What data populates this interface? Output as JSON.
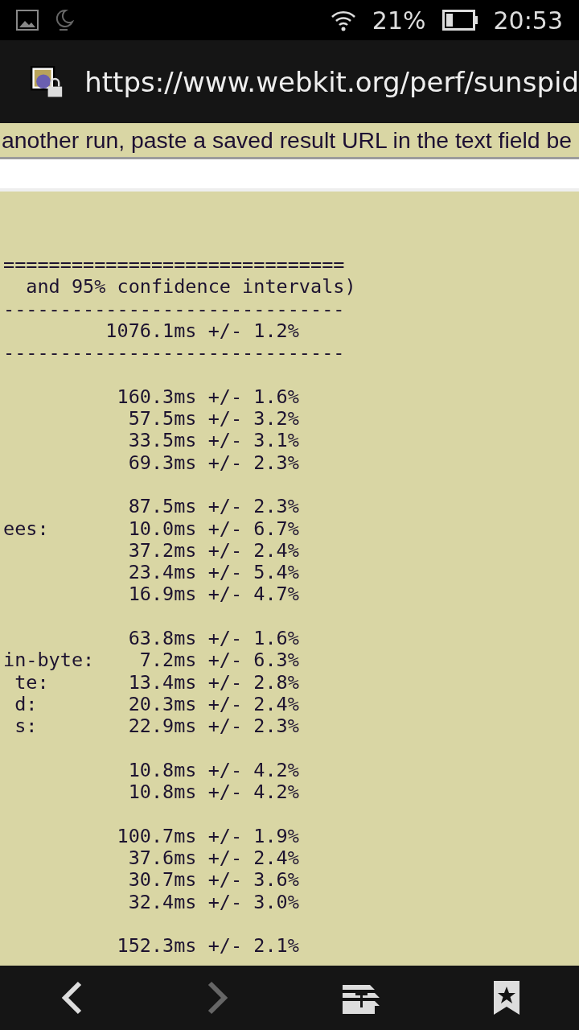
{
  "status_bar": {
    "time": "20:53",
    "battery_text": "21%"
  },
  "address_bar": {
    "url": "https://www.webkit.org/perf/sunspid",
    "secure": true
  },
  "banner": {
    "text": "another run, paste a saved result URL in the text field be"
  },
  "report_blocks": [
    [
      "==============================",
      "  and 95% confidence intervals)",
      "------------------------------",
      "         1076.1ms +/- 1.2%",
      "------------------------------"
    ],
    [
      "          160.3ms +/- 1.6%",
      "           57.5ms +/- 3.2%",
      "           33.5ms +/- 3.1%",
      "           69.3ms +/- 2.3%"
    ],
    [
      "           87.5ms +/- 2.3%",
      "ees:       10.0ms +/- 6.7%",
      "           37.2ms +/- 2.4%",
      "           23.4ms +/- 5.4%",
      "           16.9ms +/- 4.7%"
    ],
    [
      "           63.8ms +/- 1.6%",
      "in-byte:    7.2ms +/- 6.3%",
      " te:       13.4ms +/- 2.8%",
      " d:        20.3ms +/- 2.4%",
      " s:        22.9ms +/- 2.3%"
    ],
    [
      "           10.8ms +/- 4.2%",
      "           10.8ms +/- 4.2%"
    ],
    [
      "          100.7ms +/- 1.9%",
      "           37.6ms +/- 2.4%",
      "           30.7ms +/- 3.6%",
      "           32.4ms +/- 3.0%"
    ],
    [
      "          152.3ms +/- 2.1%"
    ]
  ],
  "nav_bar": [
    {
      "kind": "back",
      "disabled": false
    },
    {
      "kind": "forward",
      "disabled": true
    },
    {
      "kind": "tabs",
      "disabled": false
    },
    {
      "kind": "bookmarks",
      "disabled": false
    }
  ]
}
